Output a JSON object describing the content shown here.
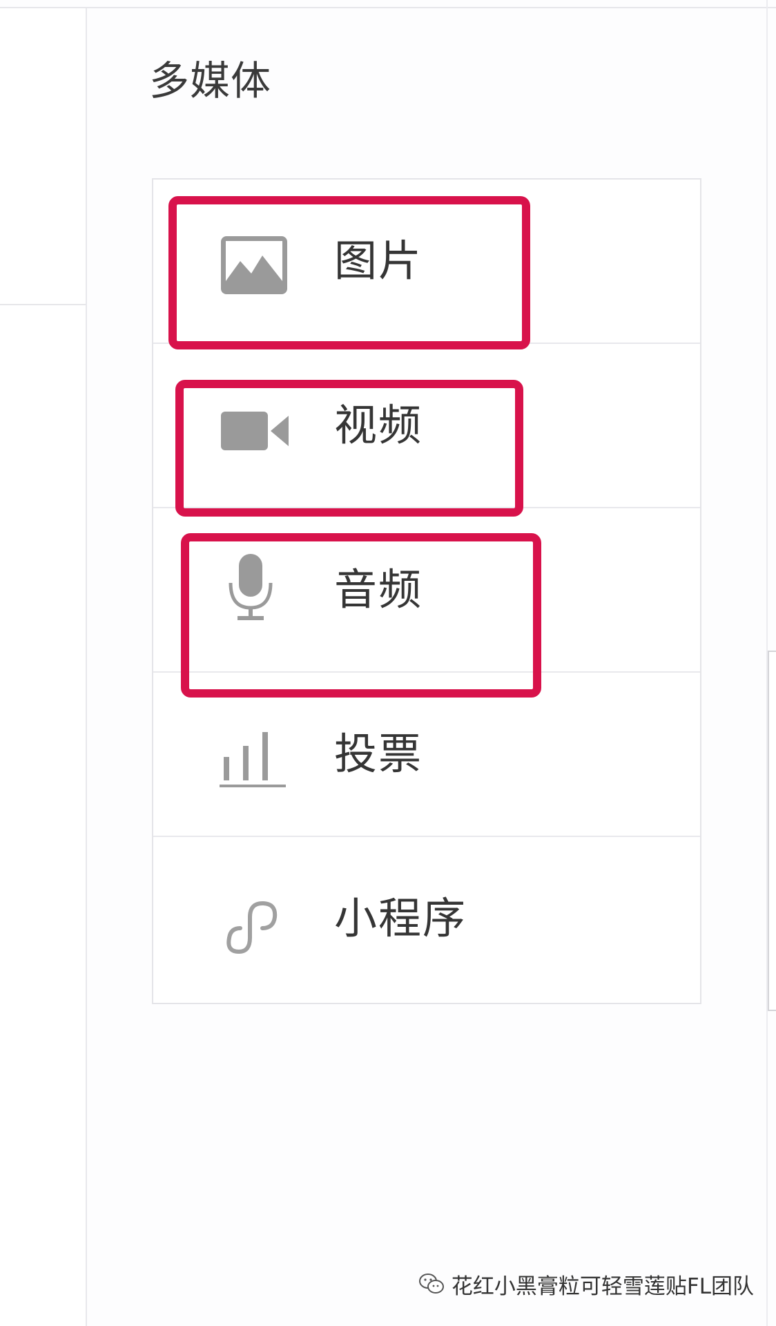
{
  "panel": {
    "title": "多媒体"
  },
  "media_items": [
    {
      "label": "图片",
      "icon": "image-icon",
      "highlighted": true
    },
    {
      "label": "视频",
      "icon": "video-camera-icon",
      "highlighted": true
    },
    {
      "label": "音频",
      "icon": "microphone-icon",
      "highlighted": true
    },
    {
      "label": "投票",
      "icon": "bar-chart-icon",
      "highlighted": false
    },
    {
      "label": "小程序",
      "icon": "mini-program-link-icon",
      "highlighted": false
    }
  ],
  "watermark": {
    "text": "花红小黑膏粒可轻雪莲贴FL团队",
    "icon": "wechat-icon"
  },
  "colors": {
    "highlight": "#d8124b",
    "icon": "#9a9a9a",
    "text": "#353535",
    "border": "#e4e4e8"
  }
}
